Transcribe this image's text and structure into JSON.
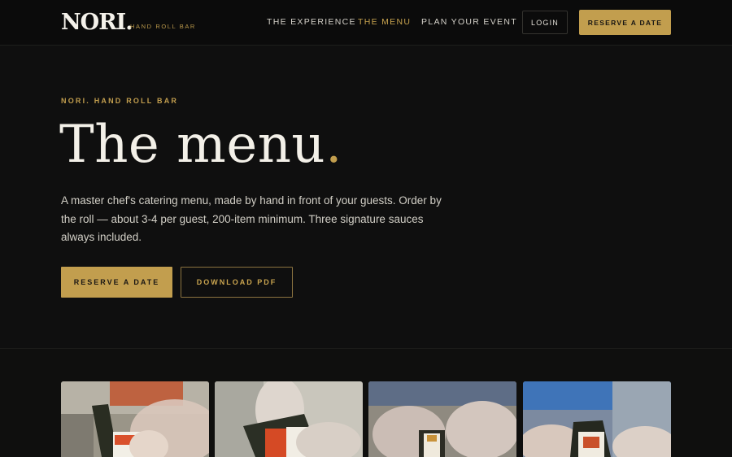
{
  "nav": {
    "logo": "NORI.",
    "logo_sub": "HAND ROLL BAR",
    "links": [
      "THE EXPERIENCE",
      "THE MENU",
      "PLAN YOUR EVENT"
    ],
    "active_link": "THE MENU",
    "login": "LOGIN",
    "reserve": "RESERVE A DATE"
  },
  "hero": {
    "eyebrow": "NORI. HAND ROLL BAR",
    "title": "The menu",
    "title_dot": ".",
    "description": "A master chef's catering menu, made by hand in front of your guests. Order by the roll — about 3-4 per guest, 200-item minimum. Three signature sauces always included.",
    "primary_button": "RESERVE A DATE",
    "secondary_button": "DOWNLOAD PDF"
  },
  "colors": {
    "accent": "#c29e4e",
    "background": "#0f0f0e",
    "text": "#e8e4da"
  }
}
